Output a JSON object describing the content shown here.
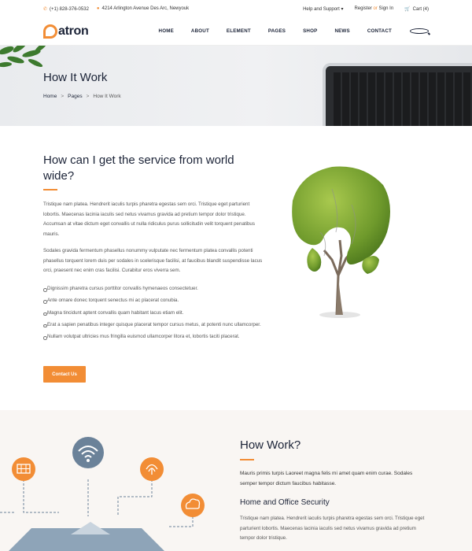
{
  "topbar": {
    "phone": "(+1) 828-376-0532",
    "address": "4214 Arlington Avenue Des Arc, Newyouk",
    "help": "Help and Support",
    "register": "Register",
    "or": "or",
    "signin": "Sign In",
    "cart": "Cart (4)"
  },
  "logo": {
    "text": "atron"
  },
  "menu": [
    "HOME",
    "ABOUT",
    "ELEMENT",
    "PAGES",
    "SHOP",
    "NEWS",
    "CONTACT"
  ],
  "hero": {
    "title": "How It Work",
    "crumbs": [
      "Home",
      "Pages",
      "How It Work"
    ],
    "sep": ">"
  },
  "section1": {
    "heading": "How can I get the service from world wide?",
    "para1": "Tristique nam platea. Hendrerit iaculis turpis pharetra egestas sem orci. Tristique eget parturient lobortis. Maecenas lacinia iaculis sed netus vivamus gravida ad pretium tempor dolor tristique. Accumsan at vitae dictum eget convallis ut nulla ridiculus purus sollicitudin velit torquent penatibus mauris.",
    "para2": "Sodales gravida fermentum phasellus nonummy vulputate nec fermentum platea convallis potenti phasellus torquent lorem duis per sodales in scelerisque facilisi, at faucibus blandit suspendisse lacus orci, praesent nec enim cras facilisi. Curabitur eros viverra sem.",
    "bullets": [
      "Dignissim pharetra cursus porttitor convallis hymenaeos consectetuer.",
      "Ante ornare donec torquent senectus mi ac placerat conubia.",
      "Magna tincidunt aptent convallis quam habitant lacus etiam elit.",
      "Erat a sapien penatibus integer quisque placerat tempor cursus metus, at potenti nunc ullamcorper.",
      "Nullam volutpat ultricies mus fringilla euismod ullamcorper litora et, lobortis taciti placerat."
    ],
    "button": "Contact Us"
  },
  "section2": {
    "heading": "How Work?",
    "intro": "Mauris primis turpis Laoreet magna felis mi amet quam enim curae. Sodales semper tempor dictum faucibus habitasse.",
    "subheading": "Home and Office Security",
    "para": "Tristique nam platea. Hendrerit iaculis turpis pharetra egestas sem orci. Tristique eget parturient lobortis. Maecenas lacinia iaculis sed netus vivamus gravida ad pretium tempor dolor tristique."
  },
  "colors": {
    "accent": "#f28d35",
    "dark": "#1b2337",
    "icon_grey": "#6b8299"
  },
  "icons": [
    "phone-icon",
    "location-icon",
    "cart-icon",
    "search-icon",
    "solar-panel-icon",
    "wifi-icon",
    "fingerprint-icon",
    "cloud-icon"
  ]
}
